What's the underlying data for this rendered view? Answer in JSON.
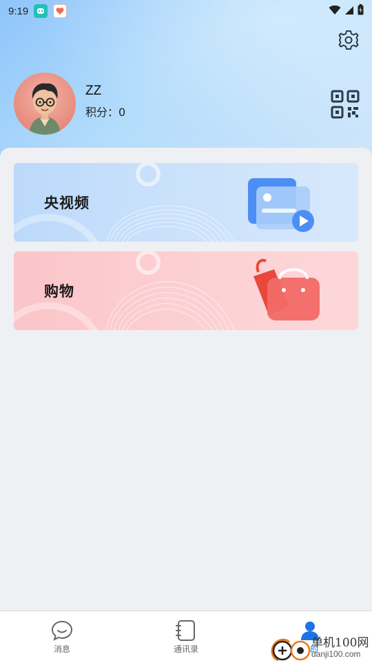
{
  "status_bar": {
    "time": "9:19"
  },
  "profile": {
    "username": "ZZ",
    "points_text": "积分：0"
  },
  "cards": [
    {
      "title": "央视频"
    },
    {
      "title": "购物"
    }
  ],
  "tabbar": {
    "tabs": [
      {
        "label": "消息"
      },
      {
        "label": "通讯录"
      },
      {
        "label": "我的"
      }
    ]
  },
  "watermark": {
    "text": "单机100网",
    "sub": "danji100.com"
  },
  "colors": {
    "accent": "#1c74e8",
    "video_card": "#c7dffb",
    "shop_card": "#fcc8cc"
  }
}
